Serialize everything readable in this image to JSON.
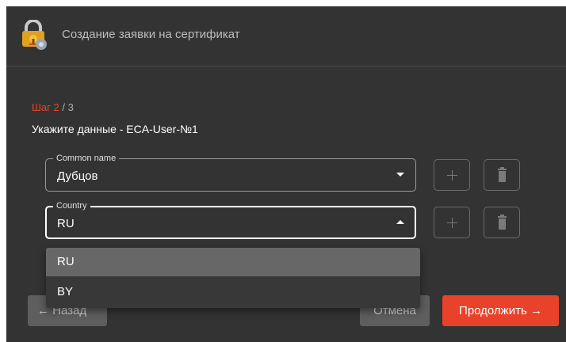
{
  "header": {
    "title": "Создание заявки на сертификат",
    "app_icon": "certificate-lock-icon"
  },
  "step": {
    "current": "Шаг 2",
    "total": " / 3",
    "subtitle": "Укажите данные - ECA-User-№1"
  },
  "fields": [
    {
      "label": "Common name",
      "value": "Дубцов",
      "state": "collapsed"
    },
    {
      "label": "Country",
      "value": "RU",
      "state": "expanded"
    }
  ],
  "dropdown": {
    "options": [
      "RU",
      "BY"
    ],
    "selected": "RU"
  },
  "buttons": {
    "back_label": "Назад",
    "back_icon": "arrow-left-icon",
    "cancel_label": "Отмена",
    "continue_label": "Продолжить",
    "continue_icon": "arrow-right-icon",
    "add_icon": "plus-icon",
    "delete_icon": "trash-icon"
  },
  "colors": {
    "accent": "#e8432a",
    "background": "#333333",
    "selected_option": "#676767"
  }
}
